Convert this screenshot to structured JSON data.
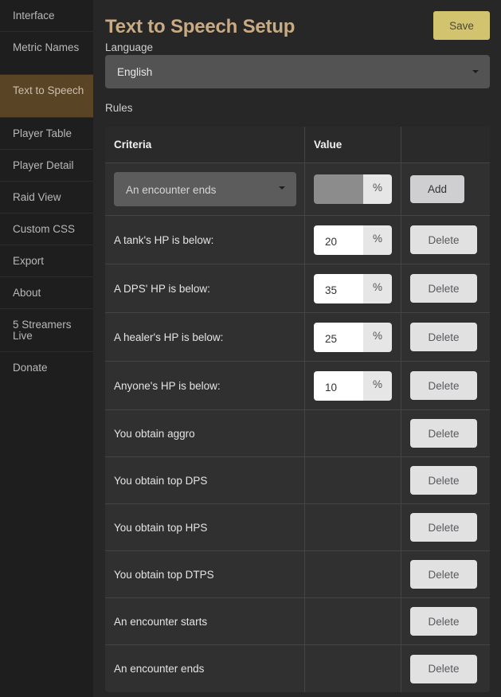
{
  "sidebar": {
    "items": [
      {
        "label": "Interface",
        "active": false
      },
      {
        "label": "Metric Names",
        "active": false
      },
      {
        "label": "Text to Speech",
        "active": true
      },
      {
        "label": "Player Table",
        "active": false
      },
      {
        "label": "Player Detail",
        "active": false
      },
      {
        "label": "Raid View",
        "active": false
      },
      {
        "label": "Custom CSS",
        "active": false
      },
      {
        "label": "Export",
        "active": false
      },
      {
        "label": "About",
        "active": false
      },
      {
        "label": "5 Streamers Live",
        "active": false
      },
      {
        "label": "Donate",
        "active": false
      }
    ]
  },
  "header": {
    "title": "Text to Speech Setup",
    "save_label": "Save"
  },
  "language": {
    "label": "Language",
    "selected": "English"
  },
  "rules": {
    "label": "Rules",
    "columns": [
      "Criteria",
      "Value",
      ""
    ],
    "new_rule": {
      "criteria_selected": "An encounter ends",
      "value": "",
      "unit": "%",
      "add_label": "Add"
    },
    "delete_label": "Delete",
    "items": [
      {
        "criteria": "A tank's HP is below:",
        "value": "20",
        "unit": "%"
      },
      {
        "criteria": "A DPS' HP is below:",
        "value": "35",
        "unit": "%"
      },
      {
        "criteria": "A healer's HP is below:",
        "value": "25",
        "unit": "%"
      },
      {
        "criteria": "Anyone's HP is below:",
        "value": "10",
        "unit": "%"
      },
      {
        "criteria": "You obtain aggro"
      },
      {
        "criteria": "You obtain top DPS"
      },
      {
        "criteria": "You obtain top HPS"
      },
      {
        "criteria": "You obtain top DTPS"
      },
      {
        "criteria": "An encounter starts"
      },
      {
        "criteria": "An encounter ends"
      }
    ]
  },
  "colors": {
    "accent_title": "#c8ab84",
    "active_nav": "#5a4426",
    "save_button": "#d2c46e"
  }
}
